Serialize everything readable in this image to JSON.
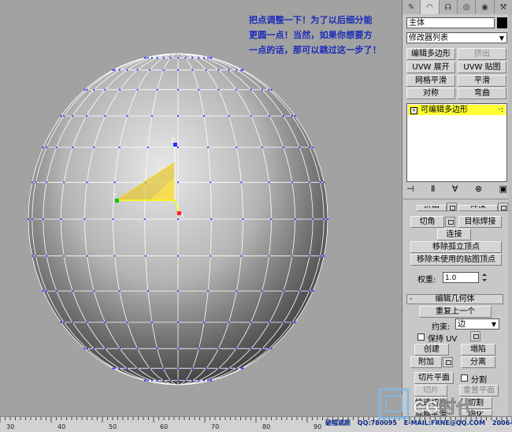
{
  "annotation": {
    "lines": [
      "把点调整一下！为了以后细分能",
      "更圆一点！当然，如果你想要方",
      "一点的话，那可以跳过这一步了！"
    ]
  },
  "panel": {
    "tabs": [
      "create-icon",
      "modify-icon",
      "hierarchy-icon",
      "motion-icon",
      "display-icon",
      "utilities-icon"
    ],
    "object_name": "主体",
    "modifier_list": "修改器列表",
    "buttons": {
      "edit_poly": "编辑多边形",
      "extrude": "挤出",
      "uvw_unwrap": "UVW 展开",
      "uvw_map": "UVW 贴图",
      "mesh_smooth": "网格平滑",
      "smooth": "平滑",
      "symmetry": "对称",
      "bend": "弯曲"
    },
    "stack_item": "可编辑多边形",
    "geometry_buttons": {
      "extrude_partial": "挤出",
      "weld_partial": "焊接",
      "chamfer": "切角",
      "target_weld": "目标焊接",
      "connect": "连接",
      "remove_isolated": "移除孤立顶点",
      "remove_unused_map": "移除未使用的贴图顶点"
    },
    "weight_label": "权重:",
    "weight_value": "1.0",
    "edit_geometry_title": "编辑几何体",
    "repeat_last": "重复上一个",
    "constraint_label": "约束:",
    "constraint_value": "边",
    "preserve_uv": "保持 UV",
    "create": "创建",
    "collapse": "塌陷",
    "attach": "附加",
    "detach": "分离",
    "slice_plane": "切片平面",
    "split": "分割",
    "slice": "切片",
    "reset_plane": "重置平面",
    "quickslice": "快速切片",
    "cut": "切割",
    "msmooth": "网格平滑",
    "tessellate": "细化"
  },
  "status": {
    "author": "破帽遮颜",
    "qq": "QQ:780095",
    "email": "E-MAIL:FRNE@QQ.COM",
    "date": "2006-8-25"
  },
  "ruler": {
    "labels": [
      "30",
      "40",
      "50",
      "60",
      "70",
      "80",
      "90"
    ]
  },
  "logo_text": "CG时代",
  "colors": {
    "annotation": "#1a2ab8",
    "stack_highlight": "#ffff33",
    "wire": "#ffffff",
    "vertex": "#3a3aff"
  }
}
